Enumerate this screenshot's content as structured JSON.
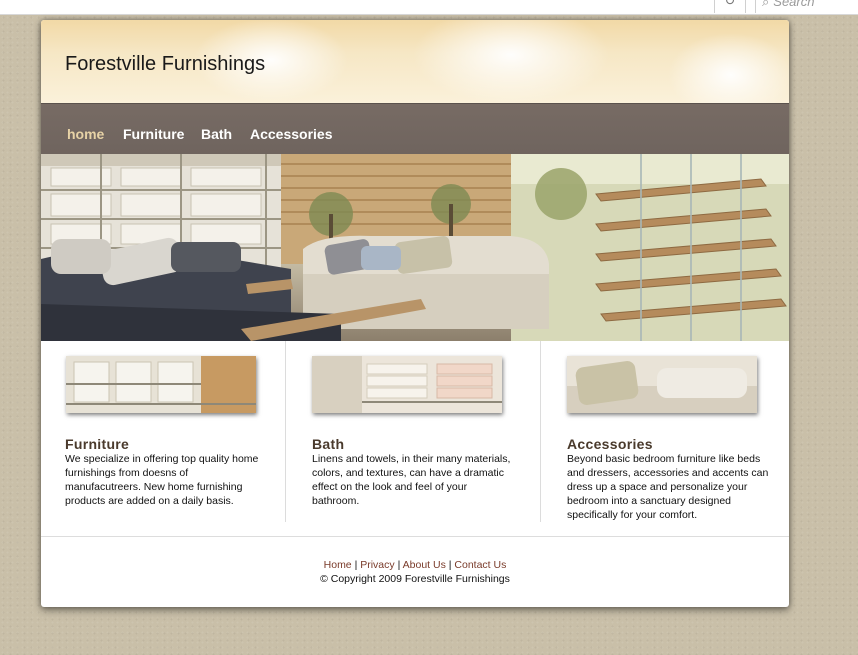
{
  "browser": {
    "reload_icon": "reload-icon",
    "search_placeholder": "Search"
  },
  "site": {
    "title": "Forestville Furnishings"
  },
  "nav": {
    "items": [
      {
        "label": "home",
        "active": true
      },
      {
        "label": "Furniture"
      },
      {
        "label": "Bath"
      },
      {
        "label": "Accessories"
      }
    ]
  },
  "features": [
    {
      "title": "Furniture",
      "text": "We specialize in offering top quality home furnishings from doesns of manufacutreers. New home furnishing products are added on a daily basis."
    },
    {
      "title": "Bath",
      "text": "Linens and towels, in their many materials, colors, and textures, can have a dramatic effect on the look and feel of your bathroom."
    },
    {
      "title": "Accessories",
      "text": "Beyond basic bedroom furniture like beds and dressers, accessories and accents can dress up a space and personalize your bedroom into a sanctuary designed specifically for your comfort."
    }
  ],
  "footer": {
    "links": [
      "Home",
      "Privacy",
      "About Us",
      "Contact Us"
    ],
    "separator": " | ",
    "copyright": "© Copyright 2009 Forestville Furnishings"
  },
  "colors": {
    "nav_bg": "#776b64",
    "nav_active": "#e7d2a6",
    "heading": "#4a3a2c",
    "footer_link": "#7a3b2a",
    "page_bg": "#c9bfa8"
  }
}
